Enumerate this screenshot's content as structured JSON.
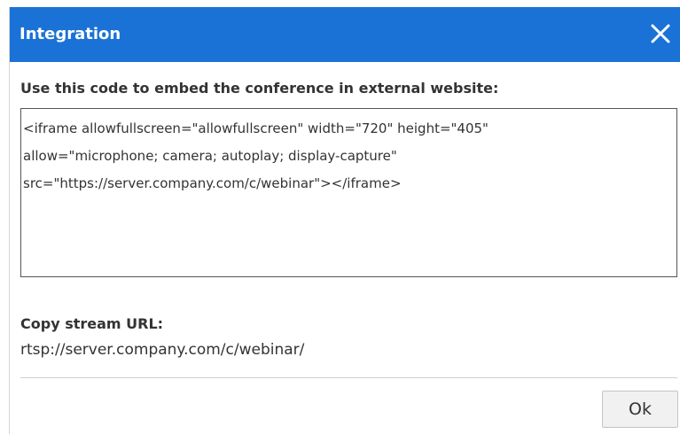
{
  "dialog": {
    "title": "Integration",
    "close_icon": "close-icon",
    "embed_label": "Use this code to embed the conference in external website:",
    "embed_code": "<iframe allowfullscreen=\"allowfullscreen\" width=\"720\" height=\"405\"\nallow=\"microphone; camera; autoplay; display-capture\"\nsrc=\"https://server.company.com/c/webinar\"></iframe>",
    "stream_label": "Copy stream URL:",
    "stream_url": "rtsp://server.company.com/c/webinar/",
    "ok_label": "Ok"
  },
  "colors": {
    "titlebar": "#1b72d6",
    "title_text": "#ffffff",
    "body_text": "#333333",
    "button_bg": "#f1f1f1"
  }
}
